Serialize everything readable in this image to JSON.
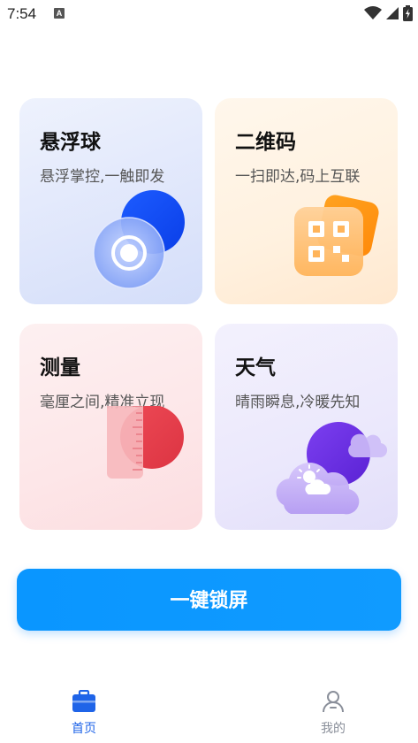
{
  "status_bar": {
    "time": "7:54",
    "notification_badge": "A"
  },
  "cards": [
    {
      "title": "悬浮球",
      "subtitle": "悬浮掌控,一触即发"
    },
    {
      "title": "二维码",
      "subtitle": "一扫即达,码上互联"
    },
    {
      "title": "测量",
      "subtitle": "毫厘之间,精准立现"
    },
    {
      "title": "天气",
      "subtitle": "晴雨瞬息,冷暖先知"
    }
  ],
  "lock_button": {
    "label": "一键锁屏"
  },
  "bottom_nav": {
    "items": [
      {
        "label": "首页",
        "active": true
      },
      {
        "label": "我的",
        "active": false
      }
    ]
  },
  "colors": {
    "primary": "#0a96ff",
    "nav_active": "#1f64e8",
    "nav_inactive": "#8a8f9a",
    "float_accent": "#1247f0",
    "qr_accent": "#ff9a14",
    "measure_accent": "#e8404f",
    "weather_accent": "#6a2fe0"
  }
}
